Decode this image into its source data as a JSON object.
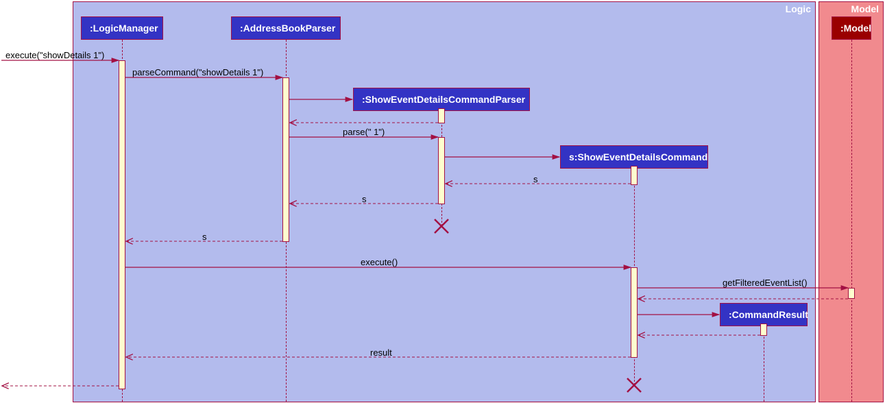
{
  "frames": {
    "logic_title": "Logic",
    "model_title": "Model"
  },
  "participants": {
    "logic_manager": ":LogicManager",
    "address_book_parser": ":AddressBookParser",
    "show_parser": ":ShowEventDetailsCommandParser",
    "show_command": "s:ShowEventDetailsCommand",
    "command_result": ":CommandResult",
    "model": ":Model"
  },
  "messages": {
    "execute_in": "execute(\"showDetails 1\")",
    "parse_command": "parseCommand(\"showDetails 1\")",
    "parse_one": "parse(\" 1\")",
    "return_s1": "s",
    "return_s2": "s",
    "return_s3": "s",
    "execute_empty": "execute()",
    "get_filtered": "getFilteredEventList()",
    "result": "result"
  }
}
